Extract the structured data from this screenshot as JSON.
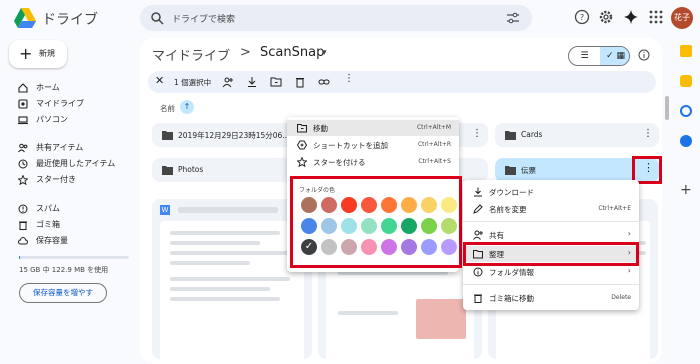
{
  "app": {
    "name": "ドライブ",
    "avatar": "花子"
  },
  "search": {
    "placeholder": "ドライブで検索"
  },
  "sidebar": {
    "new_label": "新規",
    "items": [
      {
        "label": "ホーム",
        "icon": "home-icon"
      },
      {
        "label": "マイドライブ",
        "icon": "my-drive-icon"
      },
      {
        "label": "パソコン",
        "icon": "computer-icon"
      },
      {
        "label": "共有アイテム",
        "icon": "shared-icon"
      },
      {
        "label": "最近使用したアイテム",
        "icon": "recent-icon"
      },
      {
        "label": "スター付き",
        "icon": "star-icon"
      },
      {
        "label": "スパム",
        "icon": "spam-icon"
      },
      {
        "label": "ゴミ箱",
        "icon": "trash-icon"
      },
      {
        "label": "保存容量",
        "icon": "cloud-icon"
      }
    ],
    "storage_text": "15 GB 中 122.9 MB を使用",
    "storage_fraction": 0.008,
    "more_storage": "保存容量を増やす"
  },
  "breadcrumb": {
    "root": "マイドライブ",
    "separator": ">",
    "current": "ScanSnap"
  },
  "selection": {
    "count_label": "1 個選択中"
  },
  "list": {
    "sort_label": "名前"
  },
  "folders": [
    {
      "name": "2019年12月29日23時15分06..."
    },
    {
      "name": "Cards"
    },
    {
      "name": "Photos"
    },
    {
      "name": "伝票"
    }
  ],
  "left_menu": {
    "items": [
      {
        "label": "移動",
        "shortcut": "Ctrl+Alt+M"
      },
      {
        "label": "ショートカットを追加",
        "shortcut": "Ctrl+Alt+R"
      },
      {
        "label": "スターを付ける",
        "shortcut": "Ctrl+Alt+S"
      }
    ],
    "color_title": "フォルダの色",
    "colors": [
      "#ac725e",
      "#d06b64",
      "#f83a22",
      "#fa573c",
      "#ff7537",
      "#ffad46",
      "#fad165",
      "#fbe983",
      "#4986e7",
      "#9fc6e7",
      "#9fe1e7",
      "#92e1c0",
      "#42d692",
      "#16a765",
      "#7bd148",
      "#b3dc6c",
      "#3c4043",
      "#c2c2c2",
      "#cca6ac",
      "#f691b2",
      "#cd74e6",
      "#a47ae2",
      "#9a9cff",
      "#b99aff"
    ]
  },
  "right_menu": {
    "items": [
      {
        "label": "ダウンロード",
        "shortcut": ""
      },
      {
        "label": "名前を変更",
        "shortcut": "Ctrl+Alt+E"
      },
      {
        "label": "共有",
        "shortcut": ""
      },
      {
        "label": "整理",
        "shortcut": ""
      },
      {
        "label": "フォルダ情報",
        "shortcut": ""
      },
      {
        "label": "ゴミ箱に移動",
        "shortcut": "Delete"
      }
    ]
  },
  "colors": {
    "accent": "#0b57d0",
    "highlight": "#d9001b",
    "selected_folder": "#c2e7ff"
  }
}
